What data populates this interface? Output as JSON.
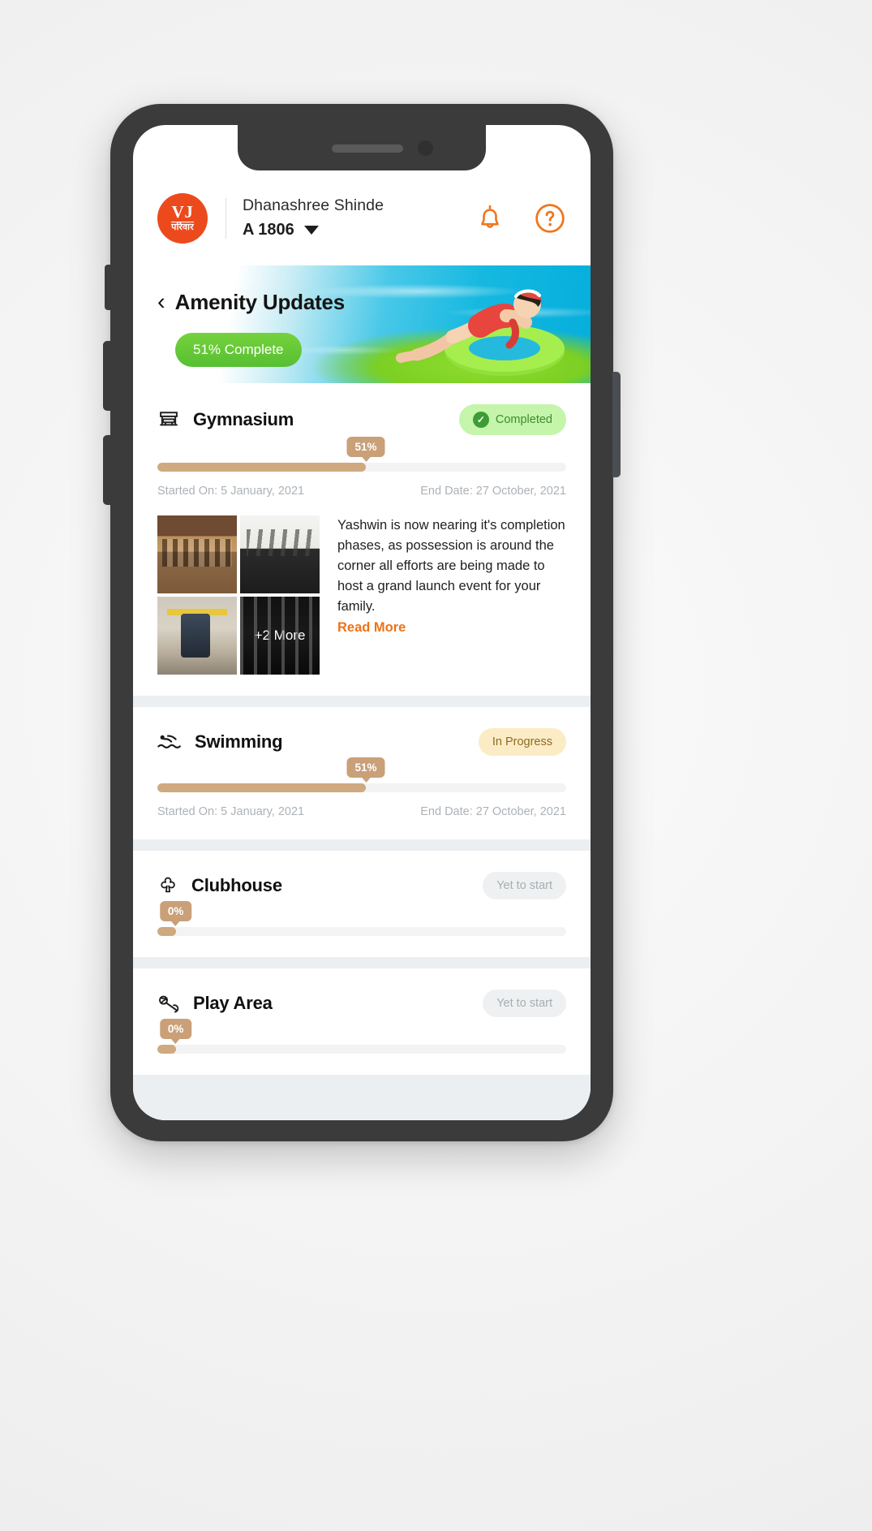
{
  "header": {
    "logo_initials": "VJ",
    "logo_subtitle": "परिवार",
    "user_name": "Dhanashree Shinde",
    "flat_number": "A 1806",
    "notification_icon": "bell-icon",
    "help_icon": "help-circle-icon",
    "dropdown_icon": "caret-down-icon"
  },
  "banner": {
    "back_icon": "chevron-left-icon",
    "title": "Amenity Updates",
    "progress_pill": "51% Complete",
    "pill_color": "#5fc533",
    "image_alt": "woman-floating-on-pool-ring"
  },
  "amenities": [
    {
      "icon": "gym-bench-icon",
      "title": "Gymnasium",
      "status_label": "Completed",
      "status_type": "completed",
      "status_icon": "check-circle-icon",
      "progress_percent": 51,
      "progress_label": "51%",
      "started_on": "Started On: 5 January, 2021",
      "end_date": "End Date: 27 October, 2021",
      "thumbnails": [
        {
          "alt": "gym-cardio-room"
        },
        {
          "alt": "gym-weights-room"
        },
        {
          "alt": "gym-man-lifting"
        },
        {
          "alt": "gym-treadmills",
          "overlay": "+2 More"
        }
      ],
      "description": "Yashwin is now nearing it's completion phases, as possession is around the corner all efforts are being made to host a grand launch event for your family.",
      "read_more": "Read More"
    },
    {
      "icon": "swimmer-icon",
      "title": "Swimming",
      "status_label": "In Progress",
      "status_type": "in-progress",
      "progress_percent": 51,
      "progress_label": "51%",
      "started_on": "Started On: 5 January, 2021",
      "end_date": "End Date: 27 October, 2021"
    },
    {
      "icon": "clubhouse-icon",
      "title": "Clubhouse",
      "status_label": "Yet to start",
      "status_type": "yet-to-start",
      "progress_percent": 0,
      "progress_label": "0%"
    },
    {
      "icon": "play-area-icon",
      "title": "Play Area",
      "status_label": "Yet to start",
      "status_type": "yet-to-start",
      "progress_percent": 0,
      "progress_label": "0%"
    }
  ],
  "colors": {
    "brand_orange": "#ec4a1d",
    "accent_orange": "#ee7219",
    "progress_tan": "#cfa97f",
    "bubble_tan": "#c9a078",
    "green": "#5fc533"
  }
}
